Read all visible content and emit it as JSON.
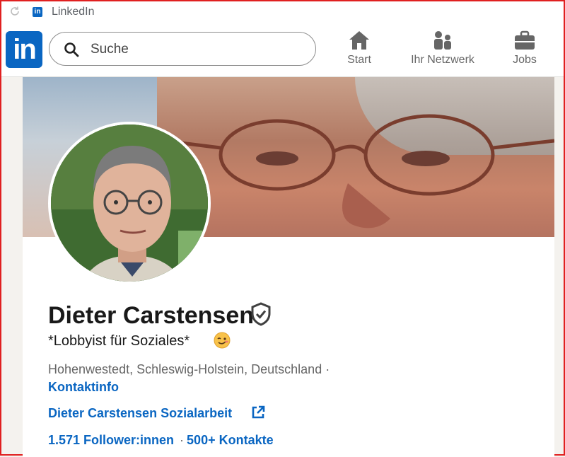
{
  "browser_tab": {
    "title": "LinkedIn",
    "favicon": "in"
  },
  "navbar": {
    "logo": "in",
    "search_placeholder": "Suche",
    "items": [
      {
        "label": "Start",
        "icon": "home-icon"
      },
      {
        "label": "Ihr Netzwerk",
        "icon": "network-icon"
      },
      {
        "label": "Jobs",
        "icon": "briefcase-icon"
      }
    ]
  },
  "profile": {
    "name": "Dieter Carstensen",
    "headline": "*Lobbyist für Soziales*",
    "location": "Hohenwestedt, Schleswig-Holstein, Deutschland ·",
    "contact_info": "Kontaktinfo",
    "website": "Dieter Carstensen Sozialarbeit",
    "followers": "1.571 Follower:innen",
    "separator": "·",
    "connections": "500+ Kontakte"
  },
  "colors": {
    "brand": "#0a66c2",
    "text": "#191919",
    "muted": "#666666",
    "frame": "#e02020"
  }
}
